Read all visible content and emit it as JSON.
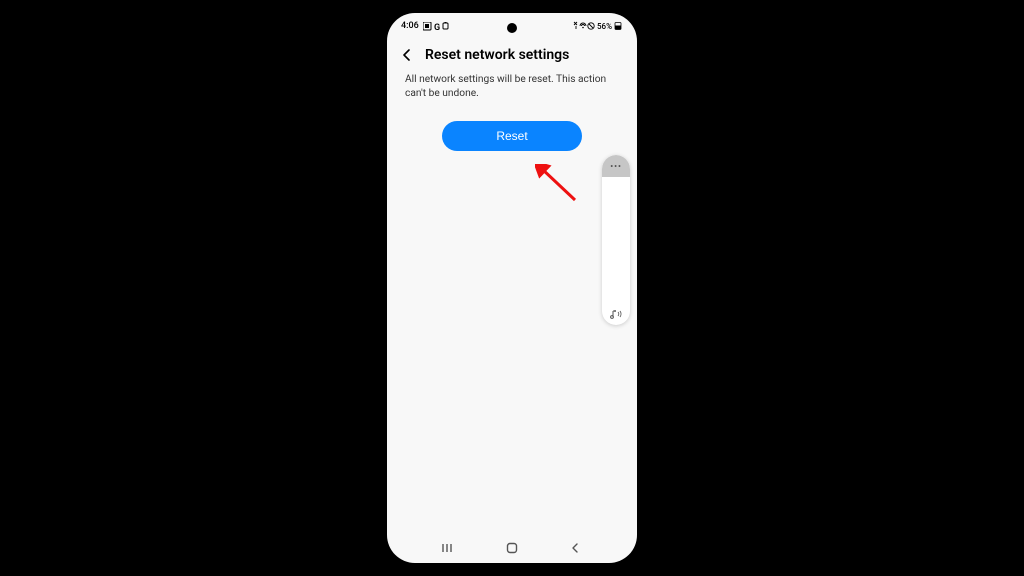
{
  "statusbar": {
    "time": "4:06",
    "left_icons": "▣ G ◯",
    "right_text": "56%",
    "right_icons": "✂ ⊗ ▲"
  },
  "header": {
    "title": "Reset network settings"
  },
  "body": {
    "description": "All network settings will be reset. This action can't be undone."
  },
  "actions": {
    "reset_label": "Reset"
  },
  "volume": {
    "more_label": "•••",
    "sound_icon": "♪)"
  }
}
